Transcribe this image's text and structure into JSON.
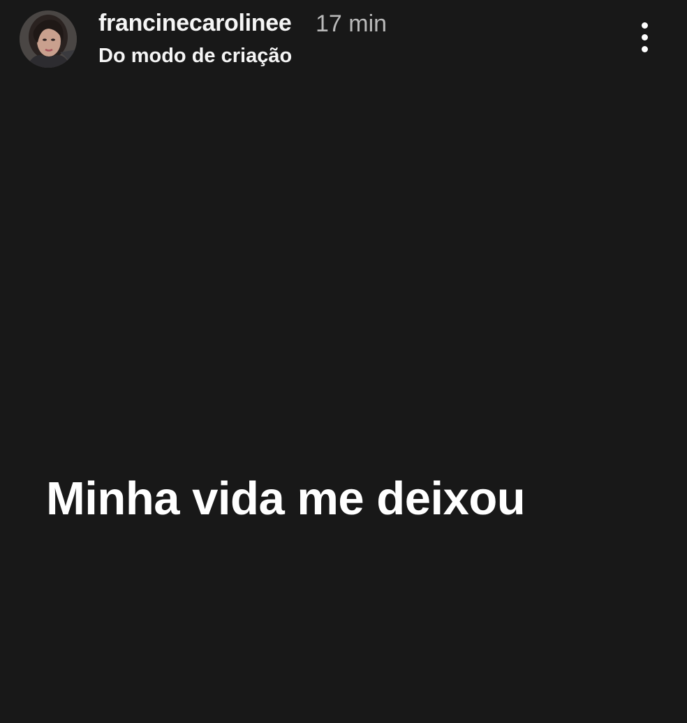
{
  "header": {
    "username": "francinecarolinee",
    "time": "17 min",
    "subtitle": "Do modo de criação",
    "avatar_icon": "profile-photo",
    "more_icon": "vertical-dots-icon"
  },
  "story": {
    "text": "Minha vida me deixou",
    "background_color": "#181818",
    "text_color": "#ffffff"
  }
}
